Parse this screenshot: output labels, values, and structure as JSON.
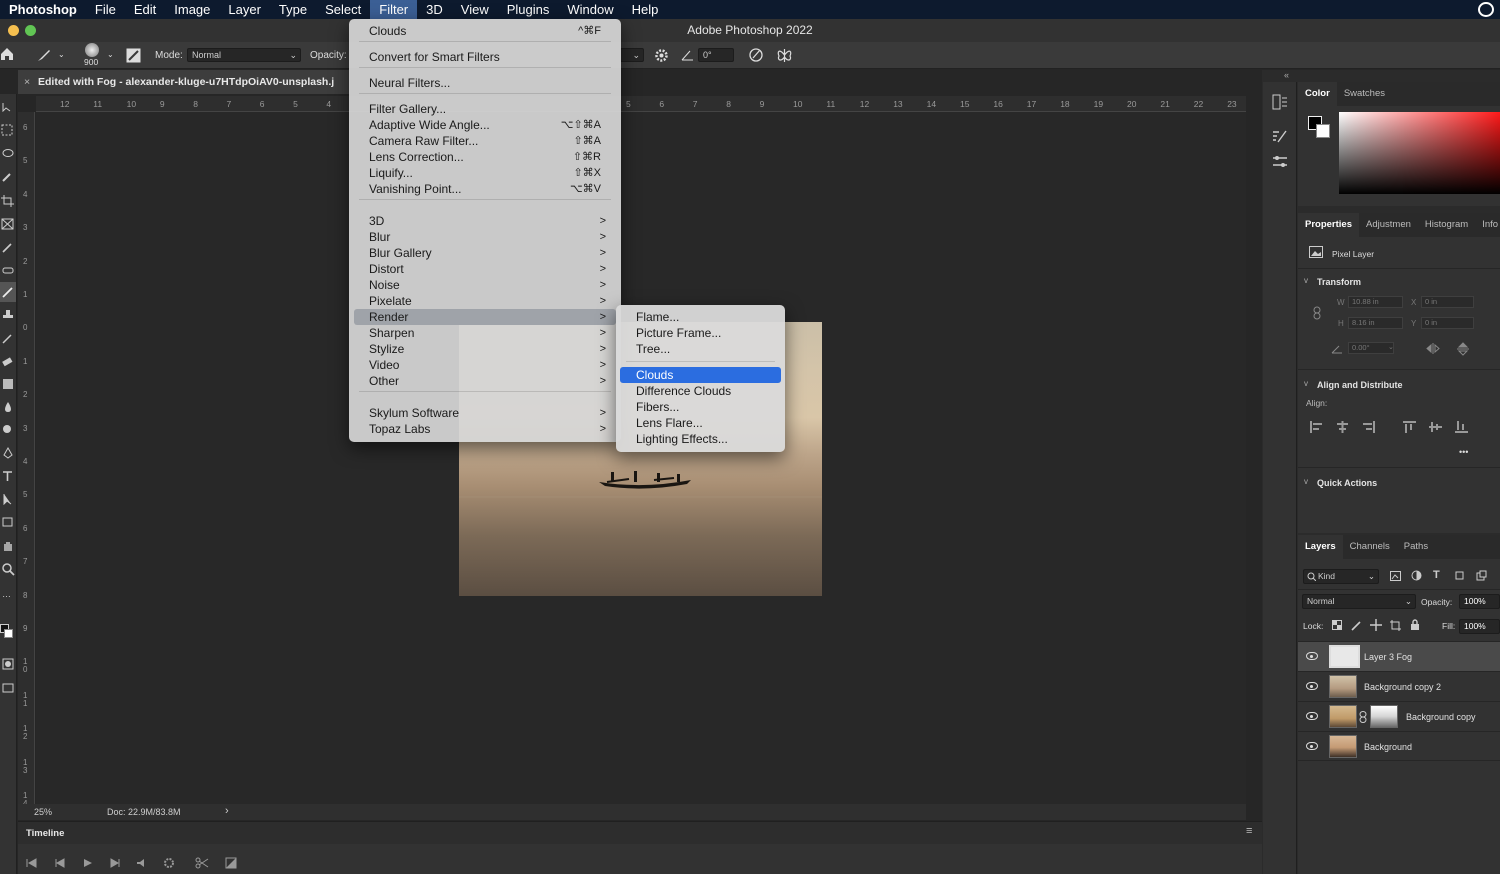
{
  "menubar": {
    "app": "Photoshop",
    "items": [
      "File",
      "Edit",
      "Image",
      "Layer",
      "Type",
      "Select",
      "Filter",
      "3D",
      "View",
      "Plugins",
      "Window",
      "Help"
    ],
    "active": "Filter"
  },
  "window": {
    "title": "Adobe Photoshop 2022"
  },
  "options": {
    "brush_size": "900",
    "mode_label": "Mode:",
    "mode_value": "Normal",
    "opacity_label": "Opacity:",
    "angle_value": "0°"
  },
  "document": {
    "tab_title": "Edited with Fog - alexander-kluge-u7HTdpOiAV0-unsplash.j",
    "close_glyph": "×",
    "zoom": "25%",
    "doc_info": "Doc: 22.9M/83.8M",
    "status_arrow": "›"
  },
  "rulers": {
    "horizontal_left": [
      "12",
      "11",
      "10",
      "9",
      "8",
      "7",
      "6",
      "5",
      "4"
    ],
    "horizontal_right": [
      "5",
      "6",
      "7",
      "8",
      "9",
      "10",
      "11",
      "12",
      "13",
      "14",
      "15",
      "16",
      "17",
      "18",
      "19",
      "20",
      "21",
      "22",
      "23"
    ],
    "vertical": [
      "6",
      "5",
      "4",
      "3",
      "2",
      "1",
      "0",
      "1",
      "2",
      "3",
      "4",
      "5",
      "6",
      "7",
      "8",
      "9",
      "1 0",
      "1 1",
      "1 2",
      "1 3",
      "1 4"
    ]
  },
  "filter_menu": {
    "items": [
      {
        "label": "Clouds",
        "shortcut": "^⌘F"
      },
      {
        "label": "Convert for Smart Filters"
      },
      {
        "label": "Neural Filters..."
      },
      {
        "label": "Filter Gallery..."
      },
      {
        "label": "Adaptive Wide Angle...",
        "shortcut": "⌥⇧⌘A"
      },
      {
        "label": "Camera Raw Filter...",
        "shortcut": "⇧⌘A"
      },
      {
        "label": "Lens Correction...",
        "shortcut": "⇧⌘R"
      },
      {
        "label": "Liquify...",
        "shortcut": "⇧⌘X"
      },
      {
        "label": "Vanishing Point...",
        "shortcut": "⌥⌘V"
      },
      {
        "label": "3D",
        "submenu": ">"
      },
      {
        "label": "Blur",
        "submenu": ">"
      },
      {
        "label": "Blur Gallery",
        "submenu": ">"
      },
      {
        "label": "Distort",
        "submenu": ">"
      },
      {
        "label": "Noise",
        "submenu": ">"
      },
      {
        "label": "Pixelate",
        "submenu": ">"
      },
      {
        "label": "Render",
        "submenu": ">"
      },
      {
        "label": "Sharpen",
        "submenu": ">"
      },
      {
        "label": "Stylize",
        "submenu": ">"
      },
      {
        "label": "Video",
        "submenu": ">"
      },
      {
        "label": "Other",
        "submenu": ">"
      },
      {
        "label": "Skylum Software",
        "submenu": ">"
      },
      {
        "label": "Topaz Labs",
        "submenu": ">"
      }
    ],
    "highlighted": "Render"
  },
  "render_submenu": {
    "items": [
      "Flame...",
      "Picture Frame...",
      "Tree...",
      "Clouds",
      "Difference Clouds",
      "Fibers...",
      "Lens Flare...",
      "Lighting Effects..."
    ],
    "selected": "Clouds"
  },
  "color_panel": {
    "tabs": [
      "Color",
      "Swatches"
    ],
    "active": "Color"
  },
  "properties_panel": {
    "tabs": [
      "Properties",
      "Adjustmen",
      "Histogram",
      "Info"
    ],
    "active": "Properties",
    "layer_kind": "Pixel Layer",
    "transform_header": "Transform",
    "w_label": "W",
    "w_value": "10.88 in",
    "h_label": "H",
    "h_value": "8.16 in",
    "x_label": "X",
    "x_value": "0 in",
    "y_label": "Y",
    "y_value": "0 in",
    "angle_value": "0.00°",
    "align_header": "Align and Distribute",
    "align_label": "Align:",
    "more": "•••",
    "quick_actions_header": "Quick Actions"
  },
  "layers_panel": {
    "tabs": [
      "Layers",
      "Channels",
      "Paths"
    ],
    "active": "Layers",
    "filter_kind": "Kind",
    "blend_mode": "Normal",
    "opacity_label": "Opacity:",
    "opacity_value": "100%",
    "lock_label": "Lock:",
    "fill_label": "Fill:",
    "fill_value": "100%",
    "layers": [
      {
        "name": "Layer 3 Fog",
        "selected": true
      },
      {
        "name": "Background copy 2"
      },
      {
        "name": "Background copy",
        "has_mask": true
      },
      {
        "name": "Background"
      }
    ]
  },
  "timeline": {
    "label": "Timeline"
  },
  "colors": {
    "menubar": "#0d1a2e",
    "menu_selection": "#2b6de0",
    "highlight_gray": "#9fa3a9"
  }
}
